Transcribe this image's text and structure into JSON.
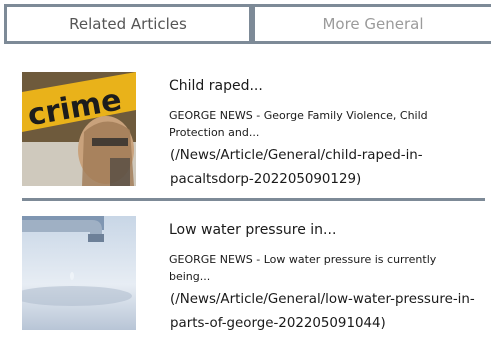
{
  "tabs": {
    "related": "Related Articles",
    "general": "More General"
  },
  "articles": [
    {
      "title": "Child raped...",
      "summary": "GEORGE NEWS - George Family Violence, Child Protection and...",
      "link_line1": "(/News/Article/General/child-raped-in-",
      "link_line2": "pacaltsdorp-202205090129)",
      "thumb_text": "crime"
    },
    {
      "title": "Low water pressure in...",
      "summary": "GEORGE NEWS - Low water pressure is currently being...",
      "link_line1": "(/News/Article/General/low-water-pressure-in-",
      "link_line2": "parts-of-george-202205091044)"
    }
  ]
}
